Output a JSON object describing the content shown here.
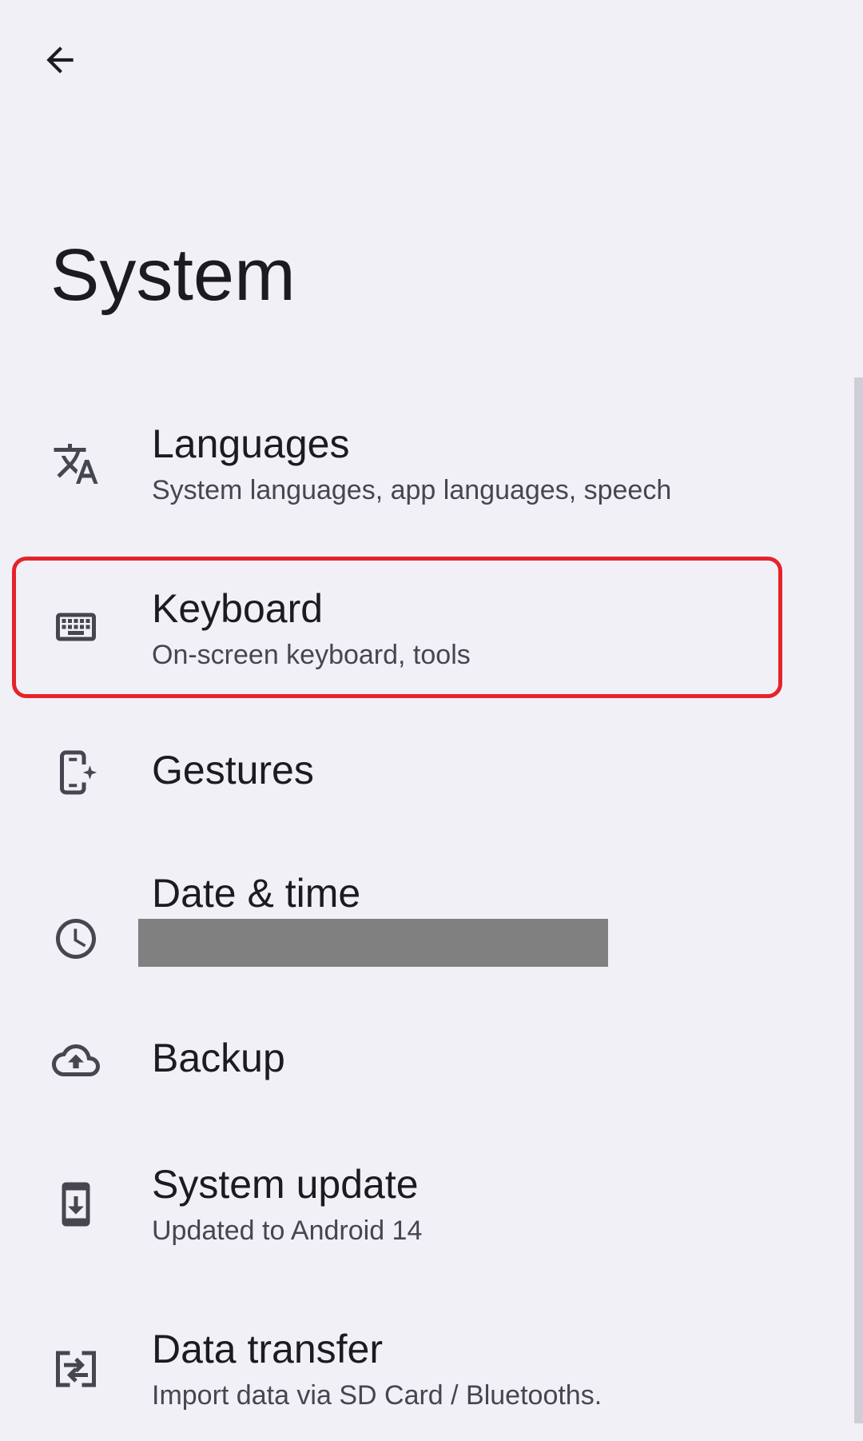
{
  "header": {
    "back_icon": "arrow-back-icon",
    "title": "System"
  },
  "colors": {
    "background": "#f1f0f7",
    "highlight_border": "#e5232b",
    "redaction": "#808080"
  },
  "items": [
    {
      "icon": "translate-icon",
      "title": "Languages",
      "subtitle": "System languages, app languages, speech"
    },
    {
      "icon": "keyboard-icon",
      "title": "Keyboard",
      "subtitle": "On-screen keyboard, tools",
      "highlighted": true
    },
    {
      "icon": "gestures-phone-icon",
      "title": "Gestures"
    },
    {
      "icon": "clock-icon",
      "title": "Date & time",
      "subtitle_redacted": true
    },
    {
      "icon": "cloud-upload-icon",
      "title": "Backup"
    },
    {
      "icon": "system-update-icon",
      "title": "System update",
      "subtitle": "Updated to Android 14"
    },
    {
      "icon": "data-transfer-icon",
      "title": "Data transfer",
      "subtitle": "Import data via SD Card / Bluetooths."
    }
  ]
}
